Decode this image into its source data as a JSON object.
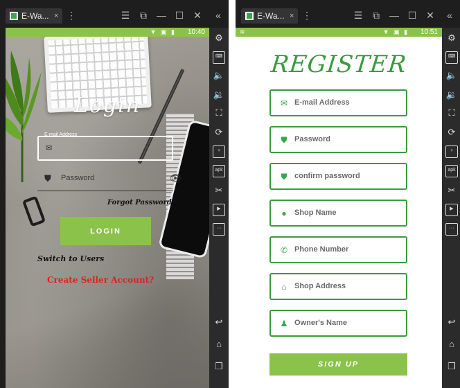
{
  "left_window": {
    "tab": {
      "label": "E-Wa...",
      "close": "×"
    },
    "status": {
      "time": "10:40"
    }
  },
  "right_window": {
    "tab": {
      "label": "E-Wa...",
      "close": "×"
    },
    "status": {
      "time": "10:51"
    }
  },
  "login": {
    "title": "Login",
    "email_label": "E-mail Address",
    "password_placeholder": "Password",
    "forgot_password": "Forgot Password?",
    "login_button": "LOGIN",
    "switch_users": "Switch to Users",
    "create_seller": "Create Seller Account?"
  },
  "register": {
    "title": "REGISTER",
    "fields": [
      {
        "label": "E-mail Address",
        "icon": "email-icon"
      },
      {
        "label": "Password",
        "icon": "shield-icon"
      },
      {
        "label": "confirm password",
        "icon": "shield-icon"
      },
      {
        "label": "Shop Name",
        "icon": "user-circle-icon"
      },
      {
        "label": "Phone Number",
        "icon": "phone-icon"
      },
      {
        "label": "Shop Address",
        "icon": "home-icon"
      },
      {
        "label": "Owner's Name",
        "icon": "person-icon"
      }
    ],
    "signup_button": "SIGN UP"
  },
  "colors": {
    "accent_green": "#8bc34a",
    "dark_green": "#3a9a3f",
    "seller_red": "#d8251c"
  }
}
